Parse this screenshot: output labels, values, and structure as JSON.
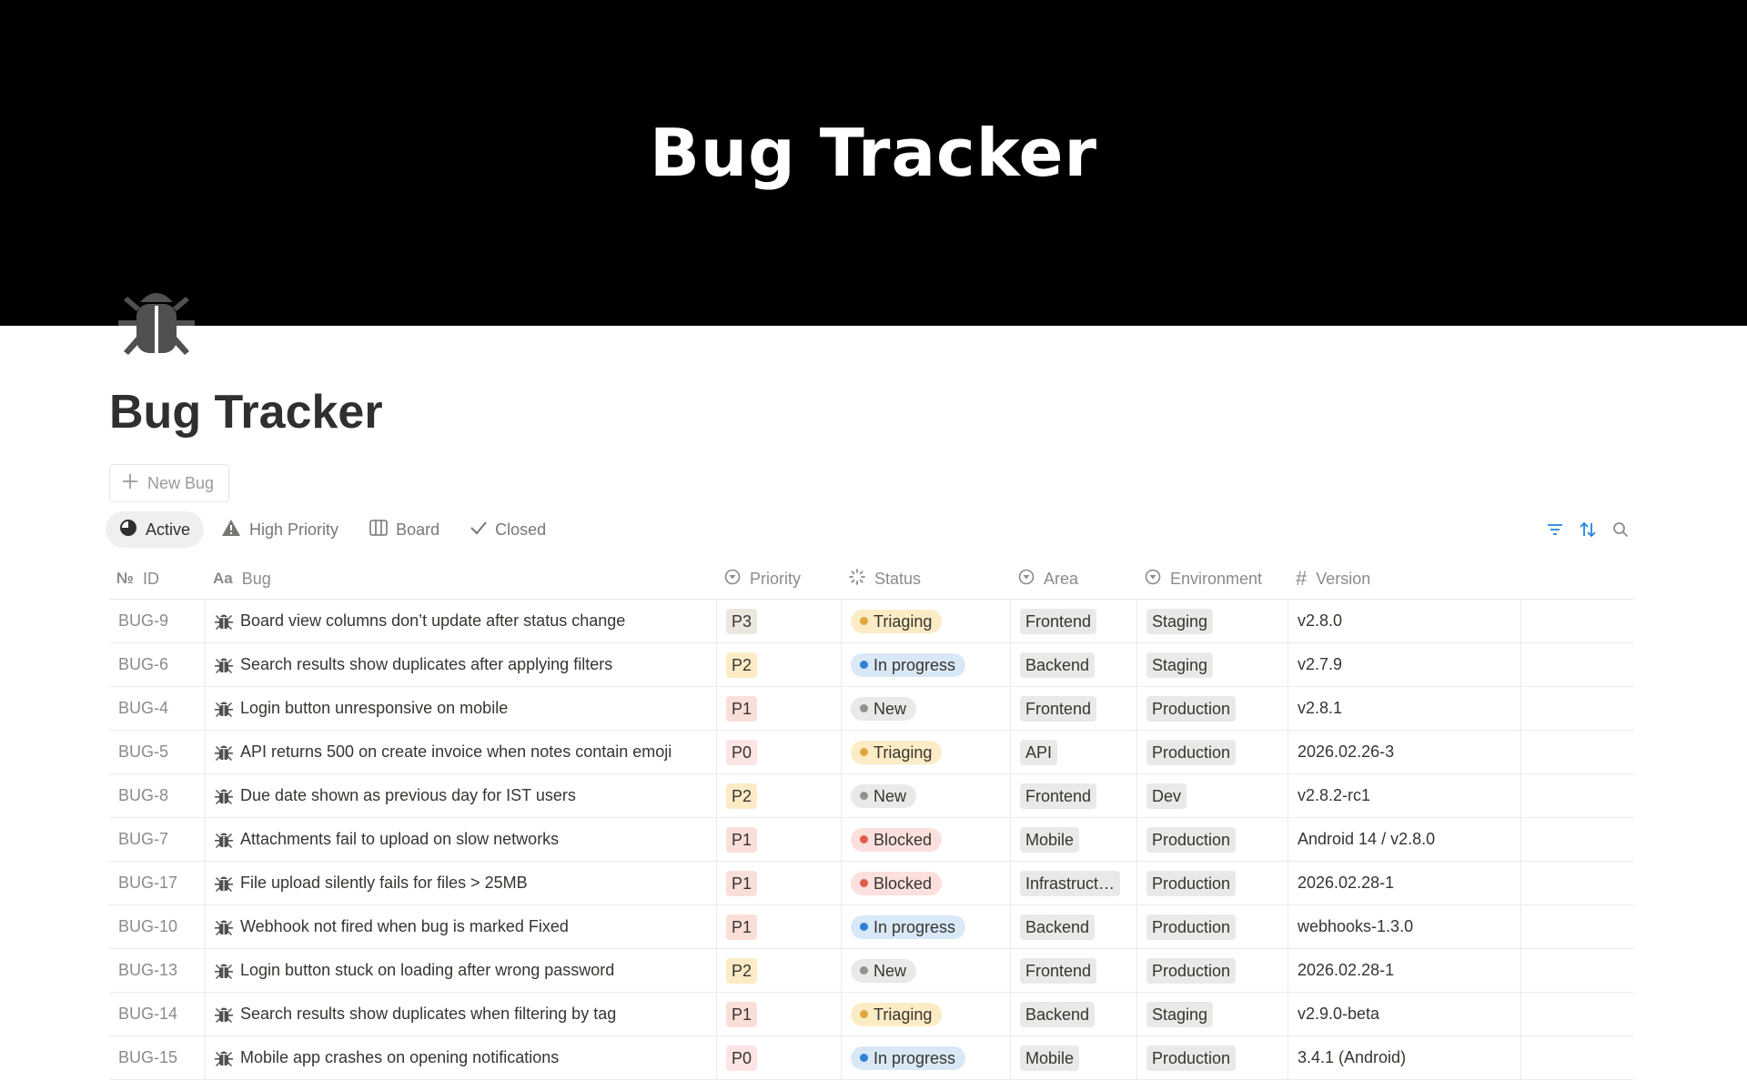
{
  "cover": {
    "title": "Bug Tracker"
  },
  "page": {
    "title": "Bug Tracker",
    "icon": "bug-icon"
  },
  "new_button": {
    "label": "New Bug"
  },
  "tabs": [
    {
      "label": "Active",
      "icon": "pie-icon",
      "active": true
    },
    {
      "label": "High Priority",
      "icon": "warning-icon",
      "active": false
    },
    {
      "label": "Board",
      "icon": "board-icon",
      "active": false
    },
    {
      "label": "Closed",
      "icon": "check-icon",
      "active": false
    }
  ],
  "toolbar": {
    "icons": [
      "filter-icon",
      "sort-icon",
      "search-icon"
    ],
    "accent": "#2383e2"
  },
  "columns": [
    {
      "label": "ID",
      "icon": "number-icon"
    },
    {
      "label": "Bug",
      "icon": "text-icon"
    },
    {
      "label": "Priority",
      "icon": "select-icon"
    },
    {
      "label": "Status",
      "icon": "status-icon"
    },
    {
      "label": "Area",
      "icon": "select-icon"
    },
    {
      "label": "Environment",
      "icon": "select-icon"
    },
    {
      "label": "Version",
      "icon": "hash-icon"
    }
  ],
  "colors": {
    "priority": {
      "P0": "#fbe4e4",
      "P1": "#fadfd8",
      "P2": "#fbecc6",
      "P3": "#ece7de"
    },
    "status": {
      "Triaging": {
        "bg": "#fbecc6",
        "dot": "#dfa63a"
      },
      "In progress": {
        "bg": "#d9e8f6",
        "dot": "#2f80d6"
      },
      "New": {
        "bg": "#e9e9e7",
        "dot": "#91918e"
      },
      "Blocked": {
        "bg": "#fbe0dd",
        "dot": "#e05b4d"
      }
    }
  },
  "rows": [
    {
      "id": "BUG-9",
      "bug": "Board view columns don’t update after status change",
      "priority": "P3",
      "status": "Triaging",
      "area": "Frontend",
      "environment": "Staging",
      "version": "v2.8.0"
    },
    {
      "id": "BUG-6",
      "bug": "Search results show duplicates after applying filters",
      "priority": "P2",
      "status": "In progress",
      "area": "Backend",
      "environment": "Staging",
      "version": "v2.7.9"
    },
    {
      "id": "BUG-4",
      "bug": "Login button unresponsive on mobile",
      "priority": "P1",
      "status": "New",
      "area": "Frontend",
      "environment": "Production",
      "version": "v2.8.1"
    },
    {
      "id": "BUG-5",
      "bug": "API returns 500 on create invoice when notes contain emoji",
      "priority": "P0",
      "status": "Triaging",
      "area": "API",
      "environment": "Production",
      "version": "2026.02.26-3"
    },
    {
      "id": "BUG-8",
      "bug": "Due date shown as previous day for IST users",
      "priority": "P2",
      "status": "New",
      "area": "Frontend",
      "environment": "Dev",
      "version": "v2.8.2-rc1"
    },
    {
      "id": "BUG-7",
      "bug": "Attachments fail to upload on slow networks",
      "priority": "P1",
      "status": "Blocked",
      "area": "Mobile",
      "environment": "Production",
      "version": "Android 14 / v2.8.0"
    },
    {
      "id": "BUG-17",
      "bug": "File upload silently fails for files > 25MB",
      "priority": "P1",
      "status": "Blocked",
      "area": "Infrastruct…",
      "environment": "Production",
      "version": "2026.02.28-1"
    },
    {
      "id": "BUG-10",
      "bug": "Webhook not fired when bug is marked Fixed",
      "priority": "P1",
      "status": "In progress",
      "area": "Backend",
      "environment": "Production",
      "version": "webhooks-1.3.0"
    },
    {
      "id": "BUG-13",
      "bug": "Login button stuck on loading after wrong password",
      "priority": "P2",
      "status": "New",
      "area": "Frontend",
      "environment": "Production",
      "version": "2026.02.28-1"
    },
    {
      "id": "BUG-14",
      "bug": "Search results show duplicates when filtering by tag",
      "priority": "P1",
      "status": "Triaging",
      "area": "Backend",
      "environment": "Staging",
      "version": "v2.9.0-beta"
    },
    {
      "id": "BUG-15",
      "bug": "Mobile app crashes on opening notifications",
      "priority": "P0",
      "status": "In progress",
      "area": "Mobile",
      "environment": "Production",
      "version": "3.4.1 (Android)"
    }
  ]
}
